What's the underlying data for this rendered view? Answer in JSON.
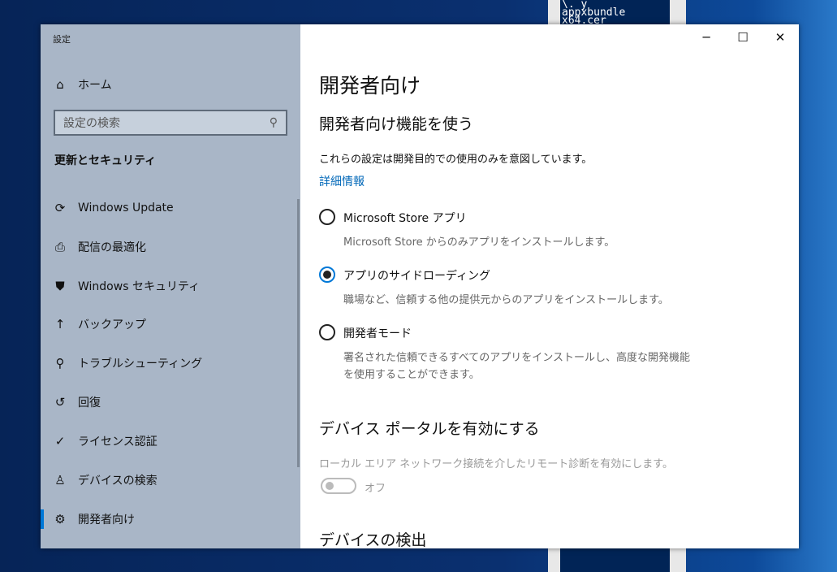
{
  "console": {
    "lines": [
      "\\. y",
      "appxbundle",
      "x64.cer"
    ]
  },
  "window": {
    "title": "設定",
    "minimize": "─",
    "maximize": "☐",
    "close": "✕"
  },
  "sidebar": {
    "home": "ホーム",
    "search_placeholder": "設定の検索",
    "section": "更新とセキュリティ",
    "items": [
      {
        "icon": "⟳",
        "label": "Windows Update"
      },
      {
        "icon": "⎙",
        "label": "配信の最適化"
      },
      {
        "icon": "⛊",
        "label": "Windows セキュリティ"
      },
      {
        "icon": "↑",
        "label": "バックアップ"
      },
      {
        "icon": "⚲",
        "label": "トラブルシューティング"
      },
      {
        "icon": "↺",
        "label": "回復"
      },
      {
        "icon": "✓",
        "label": "ライセンス認証"
      },
      {
        "icon": "♙",
        "label": "デバイスの検索"
      },
      {
        "icon": "⚙",
        "label": "開発者向け"
      }
    ]
  },
  "main": {
    "title": "開発者向け",
    "section1": "開発者向け機能を使う",
    "desc": "これらの設定は開発目的での使用のみを意図しています。",
    "link": "詳細情報",
    "options": [
      {
        "label": "Microsoft Store アプリ",
        "desc": "Microsoft Store からのみアプリをインストールします。",
        "desc2": "",
        "selected": false
      },
      {
        "label": "アプリのサイドローディング",
        "desc": "職場など、信頼する他の提供元からのアプリをインストールします。",
        "desc2": "",
        "selected": true
      },
      {
        "label": "開発者モード",
        "desc": "署名された信頼できるすべてのアプリをインストールし、高度な開発機能",
        "desc2": "を使用することができます。",
        "selected": false
      }
    ],
    "section2": "デバイス ポータルを有効にする",
    "portal_desc": "ローカル エリア ネットワーク接続を介したリモート診断を有効にします。",
    "toggle_state": "オフ",
    "section3": "デバイスの検出"
  },
  "colors": {
    "accent": "#0078d7",
    "sidebar": "#a9b6c7"
  }
}
